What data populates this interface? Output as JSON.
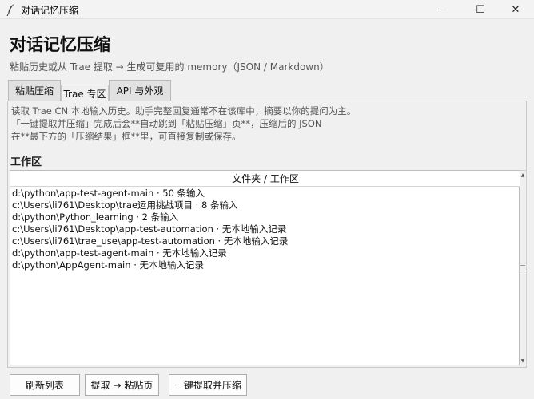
{
  "window": {
    "title": "对话记忆压缩",
    "controls": {
      "minimize": "—",
      "maximize": "☐",
      "close": "✕"
    }
  },
  "header": {
    "title": "对话记忆压缩",
    "subtitle": "粘贴历史或从 Trae 提取 → 生成可复用的 memory（JSON / Markdown）"
  },
  "tabs": [
    {
      "label": "粘贴压缩",
      "active": false
    },
    {
      "label": "Trae 专区",
      "active": true
    },
    {
      "label": "API 与外观",
      "active": false
    }
  ],
  "trae": {
    "description": "读取 Trae CN 本地输入历史。助手完整回复通常不在该库中，摘要以你的提问为主。\n「一键提取并压缩」完成后会**自动跳到「粘贴压缩」页**，压缩后的 JSON\n在**最下方的「压缩结果」框**里，可直接复制或保存。",
    "section_label": "工作区",
    "tree": {
      "column_header": "文件夹 / 工作区",
      "rows": [
        "d:\\python\\app-test-agent-main · 50 条输入",
        "c:\\Users\\li761\\Desktop\\trae运用挑战项目 · 8 条输入",
        "d:\\python\\Python_learning · 2 条输入",
        "c:\\Users\\li761\\Desktop\\app-test-automation · 无本地输入记录",
        "c:\\Users\\li761\\trae_use\\app-test-automation · 无本地输入记录",
        "d:\\python\\app-test-agent-main · 无本地输入记录",
        "d:\\python\\AppAgent-main · 无本地输入记录"
      ]
    },
    "buttons": {
      "refresh": "刷新列表",
      "extract": "提取 → 粘贴页",
      "onekey": "一键提取并压缩"
    }
  },
  "icons": {
    "app": "feather-icon",
    "scroll_up": "▲",
    "scroll_down": "▼"
  }
}
